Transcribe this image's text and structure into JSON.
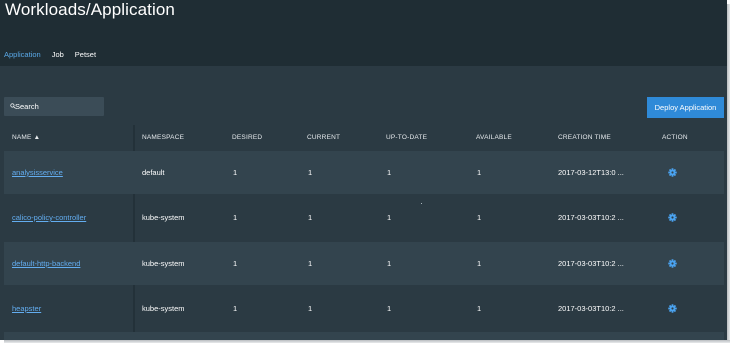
{
  "header": {
    "title": "Workloads/Application",
    "tabs": [
      {
        "label": "Application",
        "active": true
      },
      {
        "label": "Job",
        "active": false
      },
      {
        "label": "Petset",
        "active": false
      }
    ]
  },
  "toolbar": {
    "search_placeholder": "Search",
    "deploy_label": "Deploy Application"
  },
  "table": {
    "columns": {
      "name": "NAME ▲",
      "namespace": "NAMESPACE",
      "desired": "DESIRED",
      "current": "CURRENT",
      "uptodate": "UP-TO-DATE",
      "available": "AVAILABLE",
      "creation": "CREATION TIME",
      "action": "ACTION"
    },
    "rows": [
      {
        "name": "analysisservice",
        "namespace": "default",
        "desired": "1",
        "current": "1",
        "uptodate": "1",
        "available": "1",
        "creation": "2017-03-12T13:0 ..."
      },
      {
        "name": "calico-policy-controller",
        "namespace": "kube-system",
        "desired": "1",
        "current": "1",
        "uptodate": "1",
        "available": "1",
        "creation": "2017-03-03T10:2 ..."
      },
      {
        "name": "default-http-backend",
        "namespace": "kube-system",
        "desired": "1",
        "current": "1",
        "uptodate": "1",
        "available": "1",
        "creation": "2017-03-03T10:2 ..."
      },
      {
        "name": "heapster",
        "namespace": "kube-system",
        "desired": "1",
        "current": "1",
        "uptodate": "1",
        "available": "1",
        "creation": "2017-03-03T10:2 ..."
      }
    ]
  },
  "colors": {
    "background": "#2b3a43",
    "header": "#1f2d34",
    "accent": "#2f8ad8",
    "link": "#63adf0"
  }
}
